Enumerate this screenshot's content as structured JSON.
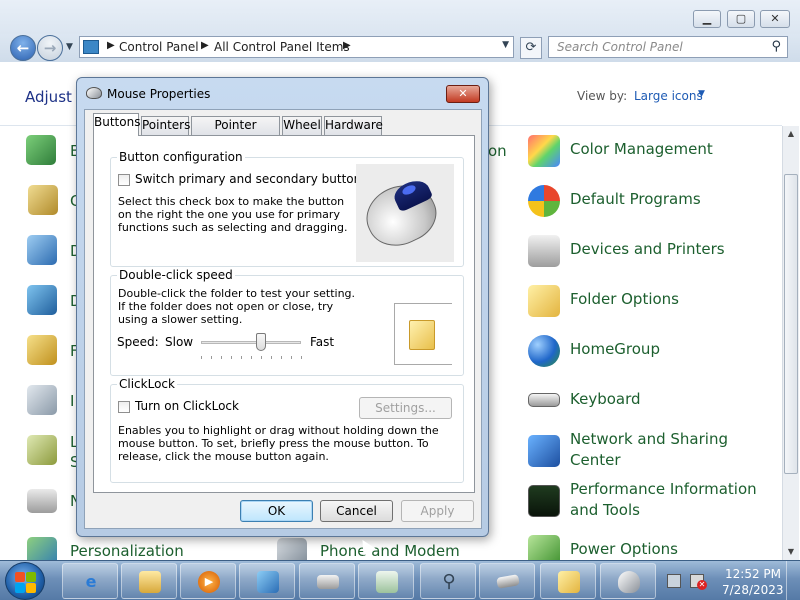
{
  "explorer": {
    "address": [
      "Control Panel",
      "All Control Panel Items"
    ],
    "search_placeholder": "Search Control Panel",
    "heading": "Adjust y",
    "view_by_label": "View by:",
    "view_by_value": "Large icons",
    "left_letters": [
      "B",
      "C",
      "D",
      "D",
      "F",
      "I",
      "L",
      "S",
      "N"
    ],
    "right_items": [
      {
        "label": "Color Management",
        "icon": "color-management-icon"
      },
      {
        "label": "Default Programs",
        "icon": "default-programs-icon"
      },
      {
        "label": "Devices and Printers",
        "icon": "devices-printers-icon"
      },
      {
        "label": "Folder Options",
        "icon": "folder-options-icon"
      },
      {
        "label": "HomeGroup",
        "icon": "homegroup-icon"
      },
      {
        "label": "Keyboard",
        "icon": "keyboard-icon"
      },
      {
        "label": "Network and Sharing\nCenter",
        "icon": "network-icon"
      },
      {
        "label": "Performance Information\nand Tools",
        "icon": "performance-icon"
      },
      {
        "label": "Power Options",
        "icon": "power-icon"
      }
    ],
    "partial_mid_top": "on",
    "bottom_left_partial": "Personalization",
    "bottom_mid_partial": "Phone and Modem"
  },
  "dialog": {
    "title": "Mouse Properties",
    "tabs": [
      "Buttons",
      "Pointers",
      "Pointer Options",
      "Wheel",
      "Hardware"
    ],
    "active_tab": 0,
    "button_config": {
      "title": "Button configuration",
      "checkbox_label": "Switch primary and secondary buttons",
      "checked": false,
      "description": "Select this check box to make the button on the right the one you use for primary functions such as selecting and dragging."
    },
    "double_click": {
      "title": "Double-click speed",
      "description": "Double-click the folder to test your setting. If the folder does not open or close, try using a slower setting.",
      "speed_label": "Speed:",
      "slow_label": "Slow",
      "fast_label": "Fast",
      "speed_value": 0.6
    },
    "clicklock": {
      "title": "ClickLock",
      "checkbox_label": "Turn on ClickLock",
      "checked": false,
      "settings_label": "Settings...",
      "description": "Enables you to highlight or drag without holding down the mouse button. To set, briefly press the mouse button. To release, click the mouse button again."
    },
    "ok_label": "OK",
    "cancel_label": "Cancel",
    "apply_label": "Apply"
  },
  "taskbar": {
    "time": "12:52 PM",
    "date": "7/28/2023",
    "buttons": [
      "internet-explorer-icon",
      "explorer-icon",
      "media-player-icon",
      "control-panel-icon",
      "projector-icon",
      "document-icon",
      "magnifier-icon",
      "keyboard-icon",
      "folder-options-icon",
      "mouse-icon"
    ]
  }
}
